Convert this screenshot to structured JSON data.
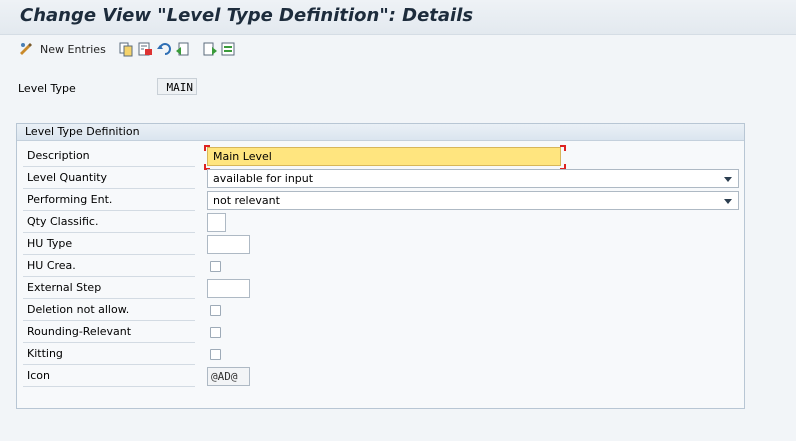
{
  "window": {
    "title": "Change View \"Level Type Definition\": Details"
  },
  "toolbar": {
    "new_entries_label": "New Entries",
    "icons": [
      "display-change-icon",
      "copy-icon",
      "delete-icon",
      "undo-icon",
      "previous-entry-icon",
      "next-entry-icon",
      "select-block-icon"
    ]
  },
  "header": {
    "level_type_label": "Level Type",
    "level_type_value": "MAIN"
  },
  "panel": {
    "title": "Level Type Definition",
    "fields": {
      "description": {
        "label": "Description",
        "value": "Main Level"
      },
      "level_quantity": {
        "label": "Level Quantity",
        "value": "available for input"
      },
      "performing_ent": {
        "label": "Performing Ent.",
        "value": "not relevant"
      },
      "qty_classific": {
        "label": "Qty Classific.",
        "value": ""
      },
      "hu_type": {
        "label": "HU Type",
        "value": ""
      },
      "hu_crea": {
        "label": "HU Crea.",
        "checked": false
      },
      "external_step": {
        "label": "External Step",
        "value": ""
      },
      "deletion_not_allow": {
        "label": "Deletion not allow.",
        "checked": false
      },
      "rounding_relevant": {
        "label": "Rounding-Relevant",
        "checked": false
      },
      "kitting": {
        "label": "Kitting",
        "checked": false
      },
      "icon": {
        "label": "Icon",
        "value": "@AD@"
      }
    }
  },
  "colors": {
    "required_field": "#ffe57f",
    "panel_border": "#b8c6d4",
    "title_text": "#1d2c3c"
  }
}
